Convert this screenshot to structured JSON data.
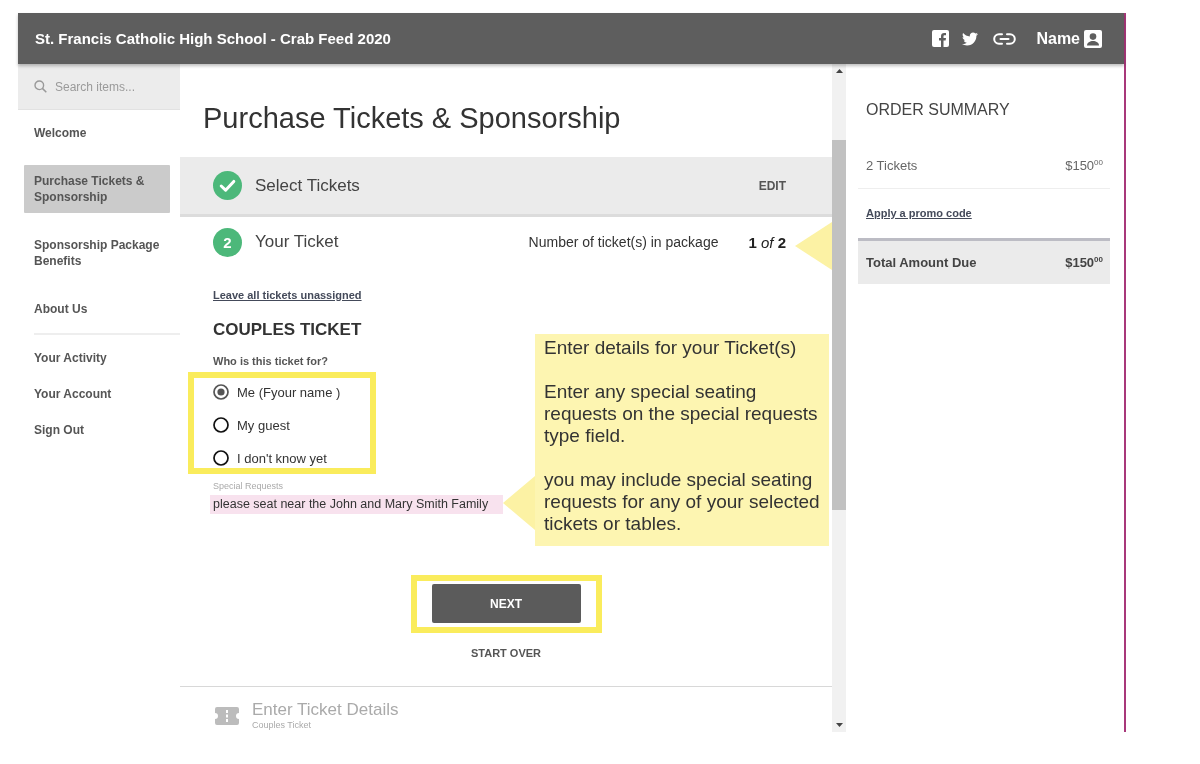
{
  "header": {
    "title": "St. Francis Catholic High School - Crab Feed 2020",
    "user_label": "Name"
  },
  "sidebar": {
    "search": {
      "placeholder": "Search items..."
    },
    "nav_items": [
      {
        "label": "Welcome",
        "selected": false
      },
      {
        "label": "Purchase Tickets & Sponsorship",
        "selected": true
      },
      {
        "label": "Sponsorship Package Benefits",
        "selected": false
      },
      {
        "label": "About Us",
        "selected": false
      }
    ],
    "account_items": [
      {
        "label": "Your Activity",
        "selected": false
      },
      {
        "label": "Your Account",
        "selected": false
      },
      {
        "label": "Sign Out",
        "selected": false
      }
    ]
  },
  "main": {
    "title": "Purchase Tickets & Sponsorship",
    "steps": [
      {
        "kind": "done",
        "title": "Select Tickets",
        "action": "EDIT"
      },
      {
        "kind": "current",
        "number": "2",
        "title": "Your Ticket",
        "count_label": "Number of ticket(s) in package",
        "count": "**1** *of* **2**"
      },
      {
        "kind": "upcoming",
        "title": "Enter Ticket Details",
        "subtitle": "Couples Ticket"
      }
    ],
    "ticket_form": {
      "link": "Leave all tickets unassigned",
      "ticket_type": "COUPLES TICKET",
      "question": "Who is this ticket for?",
      "options": {
        "highlighted": true,
        "items": [
          {
            "label": "Me (Fyour name )",
            "selected": true
          },
          {
            "label": "My guest",
            "selected": false
          },
          {
            "label": "I don't know yet",
            "selected": false
          }
        ]
      },
      "special_requests": {
        "label": "Special Requests",
        "value": "please seat near the John and Mary Smith Family"
      },
      "next_button": {
        "label": "NEXT",
        "highlighted": true
      },
      "start_over": "START OVER"
    }
  },
  "callout": {
    "paragraphs": [
      "Enter details for your Ticket(s)",
      "Enter any special seating requests on the special requests type field.",
      "you may include special seating requests for any of your selected tickets or tables."
    ]
  },
  "order_summary": {
    "title": "ORDER SUMMARY",
    "lines": [
      {
        "label": "2 Tickets",
        "amount": "$150$^{00}$"
      }
    ],
    "promo_link": "Apply a promo code",
    "total": {
      "label": "Total Amount Due",
      "amount": "$150$^{00}$"
    }
  }
}
